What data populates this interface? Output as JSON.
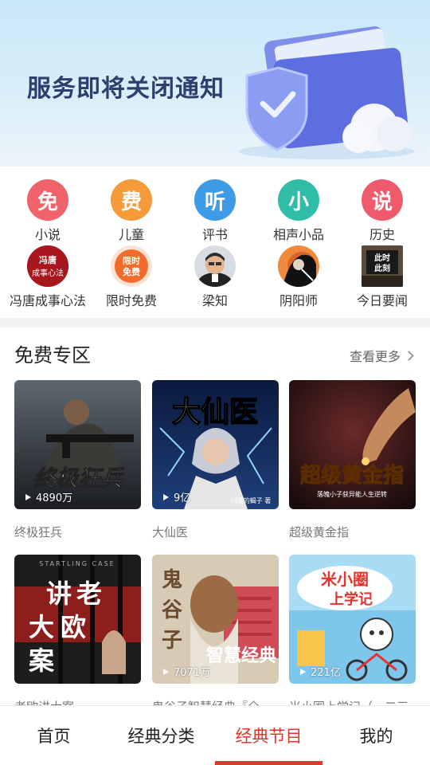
{
  "banner": {
    "title": "服务即将关闭通知"
  },
  "categories_row1": [
    {
      "glyph": "免",
      "label": "小说",
      "color": "#f0636b"
    },
    {
      "glyph": "费",
      "label": "儿童",
      "color": "#f79a3a"
    },
    {
      "glyph": "听",
      "label": "评书",
      "color": "#3f9be6"
    },
    {
      "glyph": "小",
      "label": "相声小品",
      "color": "#2fbda8"
    },
    {
      "glyph": "说",
      "label": "历史",
      "color": "#ef5b6c"
    }
  ],
  "categories_row2": [
    {
      "label": "冯唐成事心法",
      "image_text": "冯唐成事心法"
    },
    {
      "label": "限时免费",
      "image_text": "限时免费"
    },
    {
      "label": "梁知"
    },
    {
      "label": "阴阳师"
    },
    {
      "label": "今日要闻",
      "image_text": "此时此刻"
    }
  ],
  "free_section": {
    "title": "免费专区",
    "see_more": "查看更多"
  },
  "cards": [
    {
      "title": "终极狂兵",
      "cover_text": "终极狂兵",
      "play_count": "4890万"
    },
    {
      "title": "大仙医",
      "cover_text": "大仙医",
      "cover_sub": "闷骚的蝎子 著",
      "play_count": "9亿"
    },
    {
      "title": "超级黄金指",
      "cover_text": "超级黄金指",
      "cover_sub": "落魄小子获异能人生逆转",
      "play_count": ""
    },
    {
      "title": "老欧讲大案",
      "cover_text": "讲老大欧案",
      "cover_sub": "STARTLING CASE",
      "play_count": ""
    },
    {
      "title": "鬼谷子智慧经典『全",
      "cover_text": "鬼谷子",
      "cover_sub": "智慧经典",
      "play_count": "7071万"
    },
    {
      "title": "米小圈上学记（一二三",
      "cover_text": "米小圈上学记",
      "play_count": "221亿"
    }
  ],
  "tabs": [
    {
      "label": "首页",
      "active": false
    },
    {
      "label": "经典分类",
      "active": false
    },
    {
      "label": "经典节目",
      "active": true
    },
    {
      "label": "我的",
      "active": false
    }
  ]
}
